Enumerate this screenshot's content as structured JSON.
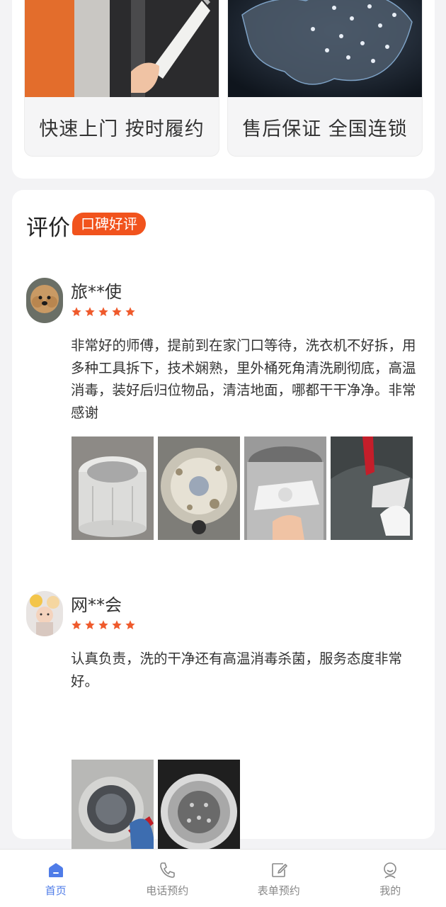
{
  "features": [
    {
      "caption": "快速上门  按时履约",
      "photo": "technician-clipboard-photo"
    },
    {
      "caption": "售后保证  全国连锁",
      "photo": "china-network-map-photo"
    }
  ],
  "reviews_section": {
    "title": "评价",
    "badge": "口碑好评"
  },
  "reviews": [
    {
      "user": "旅**使",
      "rating": 5,
      "avatar": "puppy-avatar",
      "text": "非常好的师傅，提前到在家门口等待，洗衣机不好拆，用多种工具拆下，技术娴熟，里外桶死角清洗刷彻底，高温消毒，装好后归位物品，清洁地面，哪都干干净净。非常感谢",
      "photos": [
        "washer-drum-removed-photo",
        "dirty-drum-bottom-photo",
        "pulsator-cleaning-photo",
        "inner-tub-scrubbing-photo"
      ]
    },
    {
      "user": "网**会",
      "rating": 5,
      "avatar": "balloon-child-avatar",
      "text": "认真负责，洗的干净还有高温消毒杀菌，服务态度非常好。",
      "photos": [
        "front-loader-steam-photo",
        "front-loader-drum-photo"
      ]
    }
  ],
  "tabbar": {
    "items": [
      {
        "label": "首页",
        "icon": "home-icon",
        "active": true
      },
      {
        "label": "电话预约",
        "icon": "phone-icon",
        "active": false
      },
      {
        "label": "表单预约",
        "icon": "form-edit-icon",
        "active": false
      },
      {
        "label": "我的",
        "icon": "profile-icon",
        "active": false
      }
    ]
  },
  "colors": {
    "accent": "#f1531d",
    "tab_active": "#4f7ce8",
    "star": "#ef5a2c"
  }
}
